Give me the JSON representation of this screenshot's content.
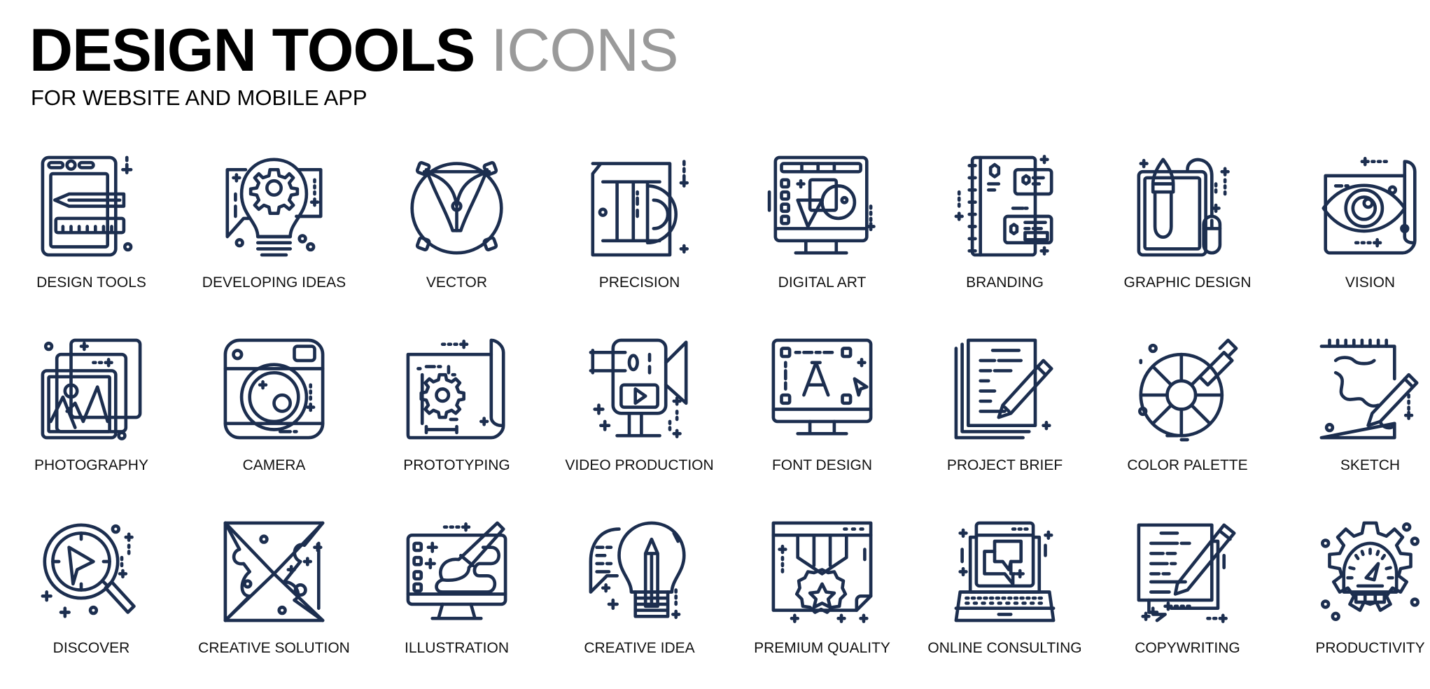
{
  "header": {
    "title_bold": "DESIGN TOOLS",
    "title_light": "ICONS",
    "subtitle": "FOR WEBSITE AND MOBILE APP"
  },
  "icon_color": "#1c2e4f",
  "icons": [
    {
      "label": "DESIGN TOOLS",
      "icon": "design-tools-icon"
    },
    {
      "label": "DEVELOPING IDEAS",
      "icon": "developing-ideas-icon"
    },
    {
      "label": "VECTOR",
      "icon": "vector-icon"
    },
    {
      "label": "PRECISION",
      "icon": "precision-icon"
    },
    {
      "label": "DIGITAL ART",
      "icon": "digital-art-icon"
    },
    {
      "label": "BRANDING",
      "icon": "branding-icon"
    },
    {
      "label": "GRAPHIC DESIGN",
      "icon": "graphic-design-icon"
    },
    {
      "label": "VISION",
      "icon": "vision-icon"
    },
    {
      "label": "PHOTOGRAPHY",
      "icon": "photography-icon"
    },
    {
      "label": "CAMERA",
      "icon": "camera-icon"
    },
    {
      "label": "PROTOTYPING",
      "icon": "prototyping-icon"
    },
    {
      "label": "VIDEO PRODUCTION",
      "icon": "video-production-icon"
    },
    {
      "label": "FONT DESIGN",
      "icon": "font-design-icon"
    },
    {
      "label": "PROJECT BRIEF",
      "icon": "project-brief-icon"
    },
    {
      "label": "COLOR PALETTE",
      "icon": "color-palette-icon"
    },
    {
      "label": "SKETCH",
      "icon": "sketch-icon"
    },
    {
      "label": "DISCOVER",
      "icon": "discover-icon"
    },
    {
      "label": "CREATIVE SOLUTION",
      "icon": "creative-solution-icon"
    },
    {
      "label": "ILLUSTRATION",
      "icon": "illustration-icon"
    },
    {
      "label": "CREATIVE IDEA",
      "icon": "creative-idea-icon"
    },
    {
      "label": "PREMIUM QUALITY",
      "icon": "premium-quality-icon"
    },
    {
      "label": "ONLINE CONSULTING",
      "icon": "online-consulting-icon"
    },
    {
      "label": "COPYWRITING",
      "icon": "copywriting-icon"
    },
    {
      "label": "PRODUCTIVITY",
      "icon": "productivity-icon"
    }
  ]
}
